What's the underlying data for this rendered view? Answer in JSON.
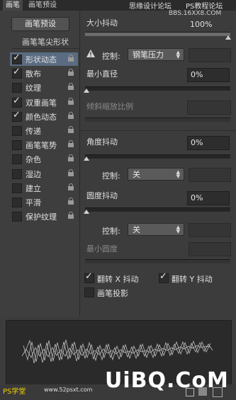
{
  "tabs": [
    {
      "label": "画笔"
    },
    {
      "label": "画笔预设"
    }
  ],
  "watermark": {
    "top_line": "思缘设计论坛",
    "top_right": "PS教程论坛",
    "url": "BBS.16XX8.COM",
    "bottom_logo": "PS学堂",
    "bottom_url": "www.52psxt.com",
    "big_text": "UiBQ.CoM"
  },
  "left": {
    "preset_button": "画笔预设",
    "tip_shape": "画笔笔尖形状",
    "items": [
      {
        "label": "形状动态",
        "checked": true,
        "selected": true
      },
      {
        "label": "散布",
        "checked": true,
        "selected": false
      },
      {
        "label": "纹理",
        "checked": false,
        "selected": false
      },
      {
        "label": "双重画笔",
        "checked": true,
        "selected": false
      },
      {
        "label": "颜色动态",
        "checked": true,
        "selected": false
      },
      {
        "label": "传递",
        "checked": false,
        "selected": false
      },
      {
        "label": "画笔笔势",
        "checked": false,
        "selected": false
      },
      {
        "label": "杂色",
        "checked": false,
        "selected": false
      },
      {
        "label": "湿边",
        "checked": false,
        "selected": false
      },
      {
        "label": "建立",
        "checked": false,
        "selected": false
      },
      {
        "label": "平滑",
        "checked": false,
        "selected": false
      },
      {
        "label": "保护纹理",
        "checked": false,
        "selected": false
      }
    ]
  },
  "right": {
    "size_jitter": {
      "label": "大小抖动",
      "value": "100%"
    },
    "control1": {
      "label": "控制:",
      "value": "钢笔压力"
    },
    "min_diameter": {
      "label": "最小直径",
      "value": "0%"
    },
    "tilt_scale": {
      "label": "倾斜缩放比例"
    },
    "angle_jitter": {
      "label": "角度抖动",
      "value": "0%"
    },
    "control2": {
      "label": "控制:",
      "value": "关"
    },
    "roundness_jitter": {
      "label": "圆度抖动",
      "value": "0%"
    },
    "control3": {
      "label": "控制:",
      "value": "关"
    },
    "min_roundness": {
      "label": "最小圆度"
    },
    "flip_x": {
      "label": "翻转 X 抖动",
      "checked": true
    },
    "flip_y": {
      "label": "翻转 Y 抖动",
      "checked": true
    },
    "brush_projection": {
      "label": "画笔投影",
      "checked": false
    }
  },
  "icons": [
    "warning-icon",
    "lock-icon",
    "chevron-updown-icon"
  ],
  "colors": {
    "selected": "#5a6b82",
    "panel": "#3c3c3c"
  }
}
